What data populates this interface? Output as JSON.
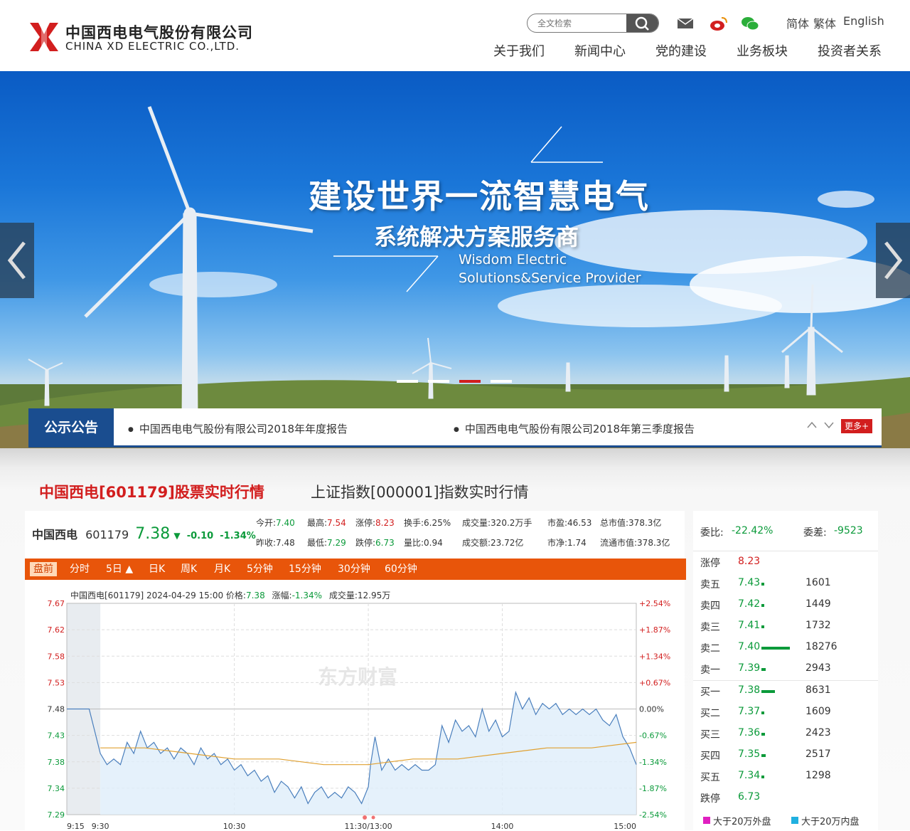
{
  "header": {
    "logo_cn": "中国西电电气股份有限公司",
    "logo_en": "CHINA XD ELECTRIC CO.,LTD.",
    "search_placeholder": "全文检索",
    "lang": [
      "简体",
      "繁体",
      "English"
    ],
    "nav": [
      "关于我们",
      "新闻中心",
      "党的建设",
      "业务板块",
      "投资者关系"
    ]
  },
  "banner": {
    "title": "建设世界一流智慧电气",
    "subtitle": "系统解决方案服务商",
    "en_line1": "Wisdom Electric",
    "en_line2": "Solutions&Service Provider",
    "active_slide": 2,
    "slides": 4
  },
  "notice": {
    "tag": "公示公告",
    "items": [
      "中国西电电气股份有限公司2018年年度报告",
      "中国西电电气股份有限公司2018年第三季度报告"
    ],
    "more": "更多+"
  },
  "quote": {
    "title_stock": "中国西电[601179]股票实时行情",
    "title_index": "上证指数[000001]指数实时行情",
    "name": "中国西电",
    "code": "601179",
    "price": "7.38",
    "arrow": "▼",
    "change": "-0.10",
    "change_pct": "-1.34%",
    "row1": [
      {
        "label": "今开:",
        "value": "7.40",
        "color": "green"
      },
      {
        "label": "最高:",
        "value": "7.54",
        "color": "red"
      },
      {
        "label": "涨停:",
        "value": "8.23",
        "color": "red"
      },
      {
        "label": "换手:",
        "value": "6.25%",
        "color": ""
      },
      {
        "label": "成交量:",
        "value": "320.2万手",
        "color": ""
      },
      {
        "label": "市盈:",
        "value": "46.53",
        "color": ""
      },
      {
        "label": "总市值:",
        "value": "378.3亿",
        "color": ""
      }
    ],
    "row2": [
      {
        "label": "昨收:",
        "value": "7.48",
        "color": ""
      },
      {
        "label": "最低:",
        "value": "7.29",
        "color": "green"
      },
      {
        "label": "跌停:",
        "value": "6.73",
        "color": "green"
      },
      {
        "label": "量比:",
        "value": "0.94",
        "color": ""
      },
      {
        "label": "成交额:",
        "value": "23.72亿",
        "color": ""
      },
      {
        "label": "市净:",
        "value": "1.74",
        "color": ""
      },
      {
        "label": "流通市值:",
        "value": "378.3亿",
        "color": ""
      }
    ],
    "tabs": [
      "盘前",
      "分时",
      "5日 ▲",
      "日K",
      "周K",
      "月K",
      "5分钟",
      "15分钟",
      "30分钟",
      "60分钟"
    ],
    "chart_info": {
      "label": "中国西电[601179]  2024-04-29 15:00  价格:",
      "price": "7.38",
      "change_label": "涨幅:",
      "change": "-1.34%",
      "volume_label": "成交量:",
      "volume": "12.95万"
    },
    "watermark": "东方财富"
  },
  "chart_data": {
    "type": "line",
    "title": "",
    "xlabel": "",
    "ylabel": "",
    "ylim": [
      7.29,
      7.67
    ],
    "prev_close": 7.48,
    "y_ticks": [
      "7.67",
      "7.62",
      "7.58",
      "7.53",
      "7.48",
      "7.43",
      "7.38",
      "7.34",
      "7.29"
    ],
    "y_right_ticks": [
      "+2.54%",
      "+1.87%",
      "+1.34%",
      "+0.67%",
      "0.00%",
      "-0.67%",
      "-1.34%",
      "-1.87%",
      "-2.54%"
    ],
    "x_ticks": [
      "9:15",
      "9:30",
      "10:30",
      "11:30/13:00",
      "14:00",
      "15:00"
    ],
    "x_tick_minutes": [
      -15,
      0,
      60,
      120,
      180,
      240
    ],
    "series": [
      {
        "name": "",
        "color": "#4a7fbd",
        "x": [
          -15,
          -10,
          -5,
          0,
          3,
          6,
          9,
          12,
          15,
          18,
          21,
          24,
          27,
          30,
          33,
          36,
          39,
          42,
          45,
          48,
          51,
          54,
          57,
          60,
          63,
          66,
          69,
          72,
          75,
          78,
          81,
          84,
          87,
          90,
          93,
          96,
          99,
          102,
          105,
          108,
          111,
          114,
          117,
          120,
          121,
          123,
          126,
          129,
          132,
          135,
          138,
          141,
          144,
          147,
          150,
          153,
          156,
          159,
          162,
          165,
          168,
          171,
          174,
          177,
          180,
          183,
          186,
          189,
          192,
          195,
          198,
          201,
          204,
          207,
          210,
          213,
          216,
          219,
          222,
          225,
          228,
          231,
          234,
          237,
          240
        ],
        "y": [
          7.48,
          7.48,
          7.48,
          7.4,
          7.38,
          7.39,
          7.38,
          7.42,
          7.4,
          7.44,
          7.41,
          7.42,
          7.4,
          7.41,
          7.39,
          7.41,
          7.4,
          7.38,
          7.41,
          7.39,
          7.4,
          7.38,
          7.39,
          7.37,
          7.38,
          7.36,
          7.37,
          7.35,
          7.36,
          7.33,
          7.35,
          7.34,
          7.32,
          7.34,
          7.31,
          7.33,
          7.34,
          7.32,
          7.33,
          7.32,
          7.34,
          7.33,
          7.31,
          7.34,
          7.38,
          7.43,
          7.37,
          7.39,
          7.37,
          7.38,
          7.37,
          7.38,
          7.37,
          7.37,
          7.38,
          7.45,
          7.42,
          7.46,
          7.44,
          7.45,
          7.43,
          7.48,
          7.44,
          7.46,
          7.43,
          7.44,
          7.51,
          7.48,
          7.5,
          7.47,
          7.49,
          7.48,
          7.49,
          7.47,
          7.48,
          7.47,
          7.48,
          7.47,
          7.48,
          7.46,
          7.45,
          7.47,
          7.43,
          7.41,
          7.38
        ]
      },
      {
        "name": "",
        "color": "#e0a030",
        "x": [
          0,
          20,
          40,
          60,
          80,
          100,
          120,
          140,
          160,
          180,
          200,
          220,
          240
        ],
        "y": [
          7.41,
          7.41,
          7.4,
          7.39,
          7.39,
          7.38,
          7.38,
          7.39,
          7.39,
          7.4,
          7.41,
          7.41,
          7.42
        ]
      }
    ]
  },
  "orderbook": {
    "wb_label": "委比:",
    "wb_value": "-22.42%",
    "wc_label": "委差:",
    "wc_value": "-9523",
    "limit_up_label": "涨停",
    "limit_up": "8.23",
    "limit_down_label": "跌停",
    "limit_down": "6.73",
    "asks": [
      {
        "label": "卖五",
        "price": "7.43",
        "vol": "1601",
        "share": 0.09
      },
      {
        "label": "卖四",
        "price": "7.42",
        "vol": "1449",
        "share": 0.08
      },
      {
        "label": "卖三",
        "price": "7.41",
        "vol": "1732",
        "share": 0.09
      },
      {
        "label": "卖二",
        "price": "7.40",
        "vol": "18276",
        "share": 1.0
      },
      {
        "label": "卖一",
        "price": "7.39",
        "vol": "2943",
        "share": 0.16
      }
    ],
    "bids": [
      {
        "label": "买一",
        "price": "7.38",
        "vol": "8631",
        "share": 0.47
      },
      {
        "label": "买二",
        "price": "7.37",
        "vol": "1609",
        "share": 0.09
      },
      {
        "label": "买三",
        "price": "7.36",
        "vol": "2423",
        "share": 0.13
      },
      {
        "label": "买四",
        "price": "7.35",
        "vol": "2517",
        "share": 0.14
      },
      {
        "label": "买五",
        "price": "7.34",
        "vol": "1298",
        "share": 0.07
      }
    ],
    "legend_out": "大于20万外盘",
    "legend_in": "大于20万内盘",
    "legend_out_color": "#e020c0",
    "legend_in_color": "#20b0e0"
  }
}
